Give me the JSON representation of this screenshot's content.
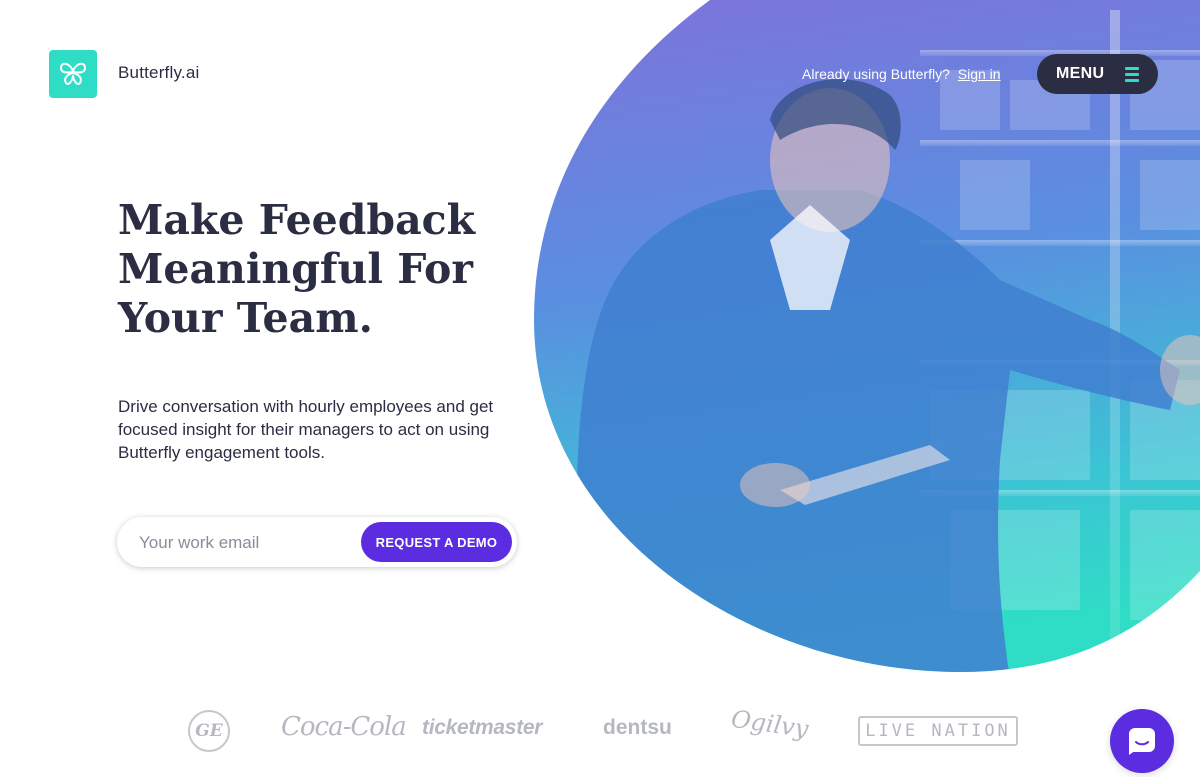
{
  "header": {
    "logo_icon": "butterfly-icon",
    "brand_name": "Butterfly.ai",
    "signin_prompt": "Already using Butterfly?",
    "signin_link": "Sign in",
    "menu_label": "MENU",
    "menu_icon": "hamburger-icon"
  },
  "hero": {
    "headline": "Make Feedback Meaningful For Your Team.",
    "subtext": "Drive conversation with hourly employees and get focused insight for their managers to act on using Butterfly engagement tools.",
    "email_placeholder": "Your work email",
    "email_value": "",
    "cta_label": "REQUEST A DEMO",
    "image": "warehouse-worker-with-tablet-photo"
  },
  "clients": [
    {
      "name": "GE",
      "text": "GE"
    },
    {
      "name": "Coca-Cola",
      "text": "Coca-Cola"
    },
    {
      "name": "ticketmaster",
      "text": "ticketmaster"
    },
    {
      "name": "dentsu",
      "text": "dentsu"
    },
    {
      "name": "Ogilvy",
      "text": "Ogilvy"
    },
    {
      "name": "Live Nation",
      "text": "LIVE NATION"
    }
  ],
  "chat": {
    "icon": "chat-bubble-icon"
  },
  "colors": {
    "brand_teal": "#2fdcc6",
    "navy": "#2b2d42",
    "purple": "#5b2ce0",
    "logo_gray": "#b6b8c0",
    "gradient_top": "#7b6fd6",
    "gradient_bottom": "#2fdcc6"
  }
}
